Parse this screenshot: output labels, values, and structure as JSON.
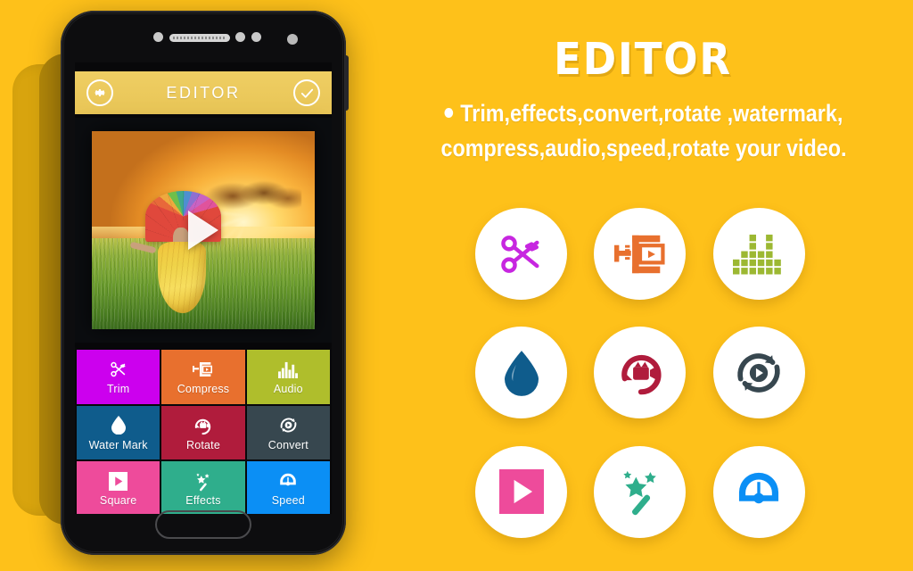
{
  "theme": {
    "background": "#FEC11A",
    "bubble_bg": "#FFFFFF",
    "title_color": "#FFFFFF"
  },
  "phone": {
    "appbar": {
      "title": "EDITOR",
      "background": "#EFCE63",
      "left_icon": "gear-icon",
      "right_icon": "check-circle-icon"
    },
    "preview": {
      "play_icon": "play-icon",
      "description": "Woman with rainbow umbrella walking in a sunlit green field at sunset"
    },
    "home_button": "home-button",
    "tiles": [
      {
        "label": "Trim",
        "color": "#CC00EE",
        "icon": "scissors-icon"
      },
      {
        "label": "Compress",
        "color": "#E8702E",
        "icon": "compress-icon"
      },
      {
        "label": "Audio",
        "color": "#AFBE2C",
        "icon": "equalizer-icon"
      },
      {
        "label": "Water Mark",
        "color": "#0F5C8C",
        "icon": "water-drop-icon"
      },
      {
        "label": "Rotate",
        "color": "#B01C3C",
        "icon": "rotate-camera-icon"
      },
      {
        "label": "Convert",
        "color": "#37474F",
        "icon": "convert-icon"
      },
      {
        "label": "Square",
        "color": "#EE4B9B",
        "icon": "square-play-icon"
      },
      {
        "label": "Effects",
        "color": "#2FAE8C",
        "icon": "magic-wand-icon"
      },
      {
        "label": "Speed",
        "color": "#0B8FF5",
        "icon": "speedometer-icon"
      }
    ]
  },
  "promo": {
    "title": "EDITOR",
    "description_line1": "Trim,effects,convert,rotate ,watermark,",
    "description_line2": "compress,audio,speed,rotate your video.",
    "feature_icons": [
      {
        "name": "scissors-icon",
        "color": "#C726E0"
      },
      {
        "name": "compress-icon",
        "color": "#E8702E"
      },
      {
        "name": "equalizer-icon",
        "color": "#9CB832"
      },
      {
        "name": "water-drop-icon",
        "color": "#0F5C8C"
      },
      {
        "name": "rotate-camera-icon",
        "color": "#B01C3C"
      },
      {
        "name": "convert-icon",
        "color": "#37474F"
      },
      {
        "name": "square-play-icon",
        "color": "#EE4B9B"
      },
      {
        "name": "magic-wand-icon",
        "color": "#2FAE8C"
      },
      {
        "name": "speedometer-icon",
        "color": "#0B8FF5"
      }
    ]
  }
}
